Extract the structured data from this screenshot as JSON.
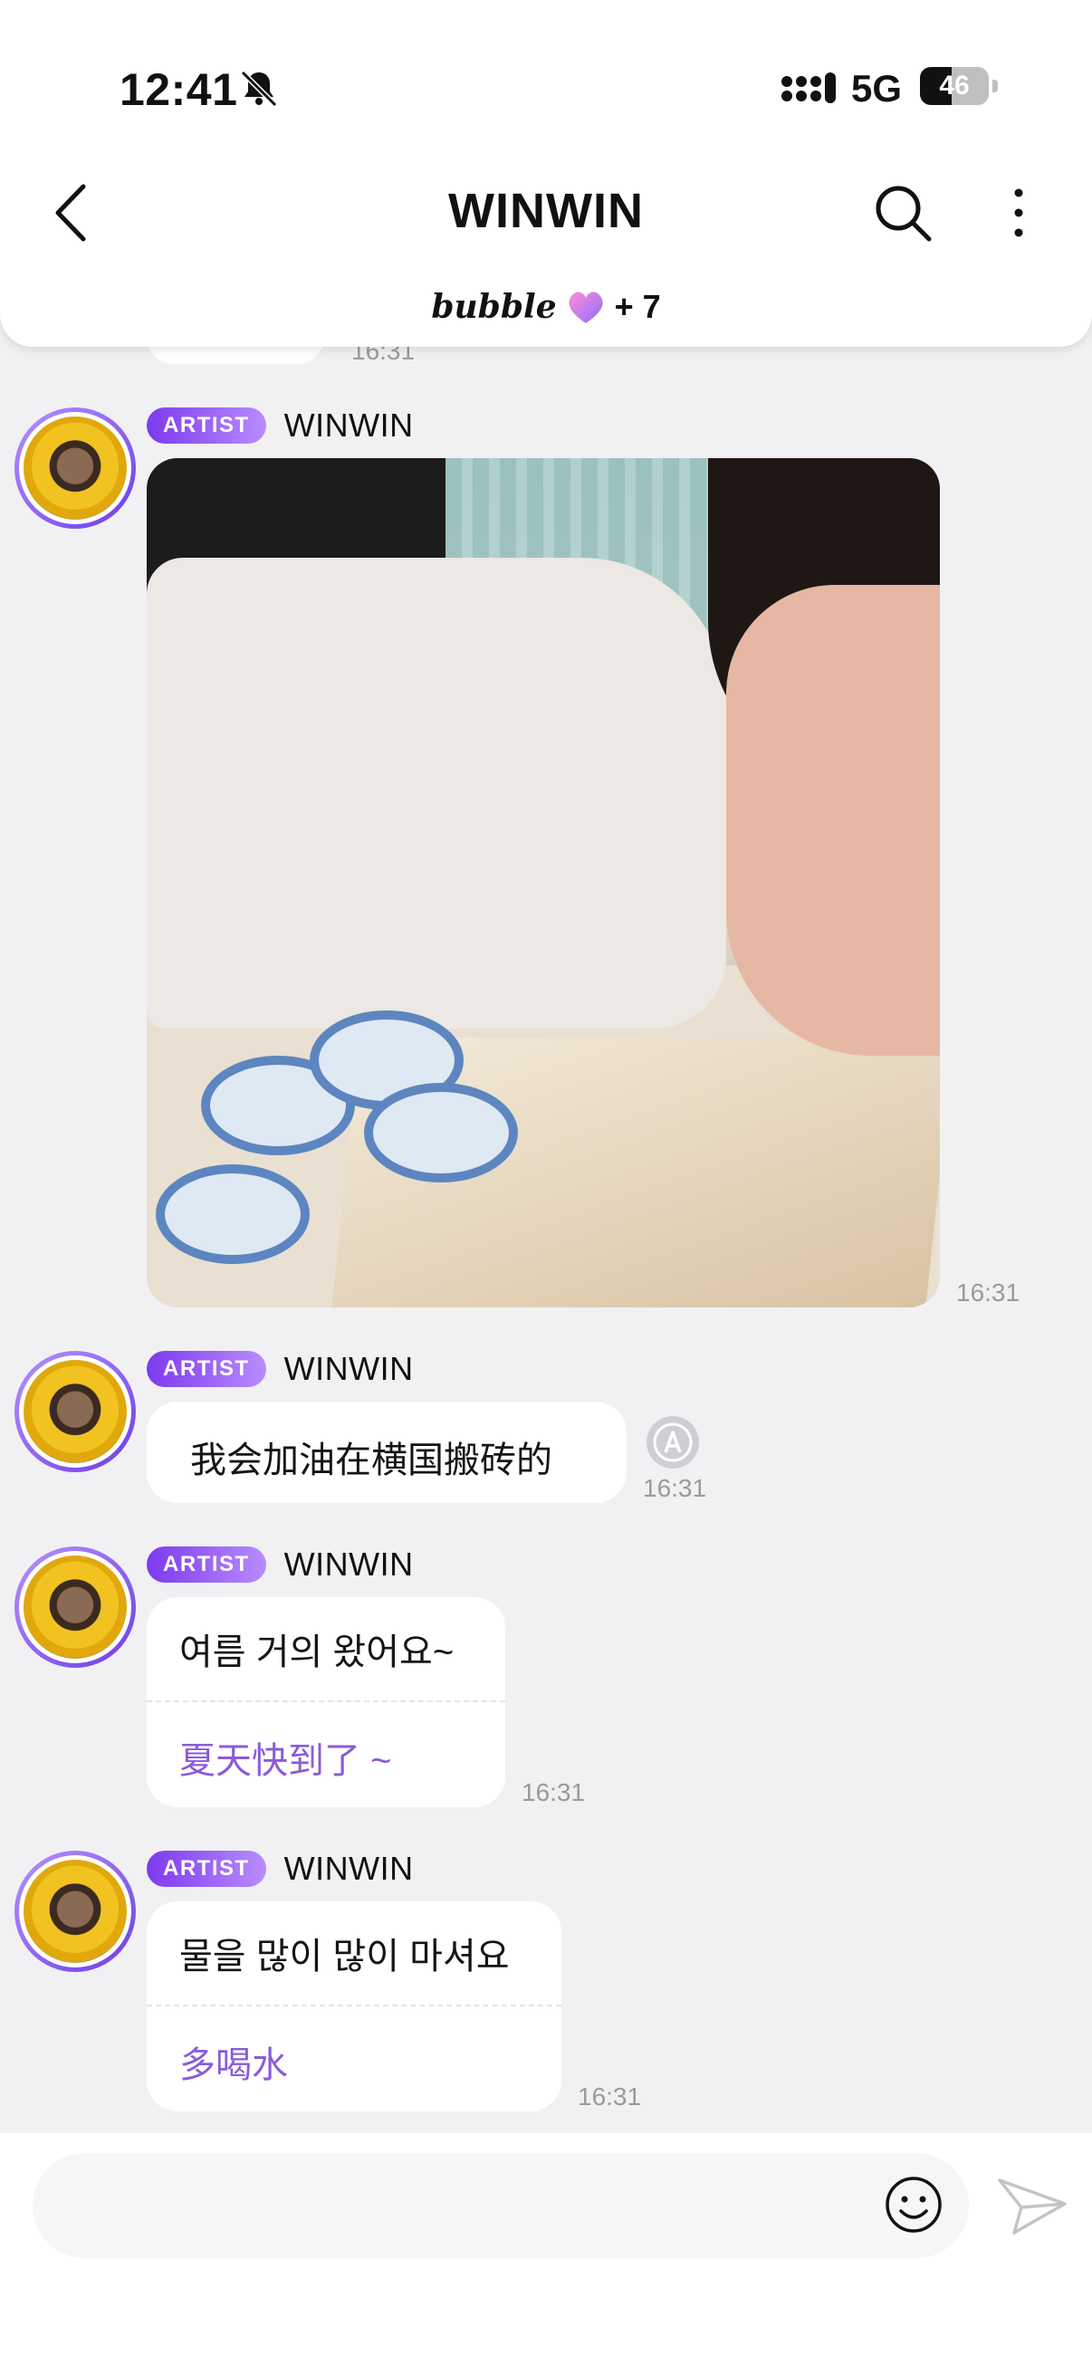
{
  "status_bar": {
    "time": "12:41",
    "network": "5G",
    "battery": "46",
    "battery_level": 0.46
  },
  "header": {
    "title": "WINWIN",
    "bubble_label": "bubble",
    "bubble_count": "+ 7"
  },
  "chat": {
    "previous_time": "16:31",
    "messages": [
      {
        "badge": "ARTIST",
        "sender": "WINWIN",
        "type": "image",
        "time": "16:31"
      },
      {
        "badge": "ARTIST",
        "sender": "WINWIN",
        "type": "text",
        "text": "我会加油在横国搬砖的",
        "time": "16:31"
      },
      {
        "badge": "ARTIST",
        "sender": "WINWIN",
        "type": "text",
        "text": "여름 거의 왔어요~",
        "translation": "夏天快到了 ~",
        "time": "16:31"
      },
      {
        "badge": "ARTIST",
        "sender": "WINWIN",
        "type": "text",
        "text": "물을 많이 많이 마셔요",
        "translation": "多喝水",
        "time": "16:31"
      }
    ]
  },
  "input": {
    "placeholder": ""
  },
  "colors": {
    "accent": "#7c3aed",
    "translation_text": "#8b5bd8",
    "background": "#f1f1f3"
  }
}
